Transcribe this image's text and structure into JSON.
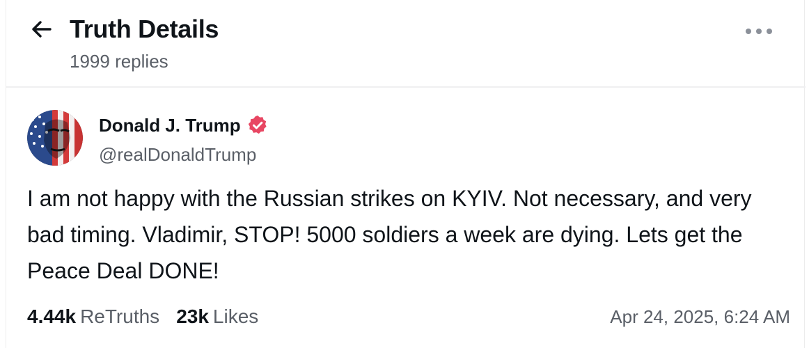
{
  "header": {
    "title": "Truth Details",
    "reply_count": "1999 replies",
    "back_icon": "arrow-left-icon",
    "more_icon": "more-horizontal-icon"
  },
  "post": {
    "author": {
      "name": "Donald J. Trump",
      "handle": "@realDonaldTrump",
      "verified": true,
      "verified_color": "#e84763"
    },
    "body": "I am not happy with the Russian strikes on KYIV. Not necessary, and very bad timing. Vladimir, STOP! 5000 soldiers a week are dying. Lets get the Peace Deal DONE!",
    "retruths": {
      "count": "4.44k",
      "label": "ReTruths"
    },
    "likes": {
      "count": "23k",
      "label": "Likes"
    },
    "timestamp": "Apr 24, 2025, 6:24 AM"
  },
  "colors": {
    "text_primary": "#0f1419",
    "text_secondary": "#5a5f67",
    "divider": "#efeff1",
    "verified_badge": "#e84763"
  }
}
